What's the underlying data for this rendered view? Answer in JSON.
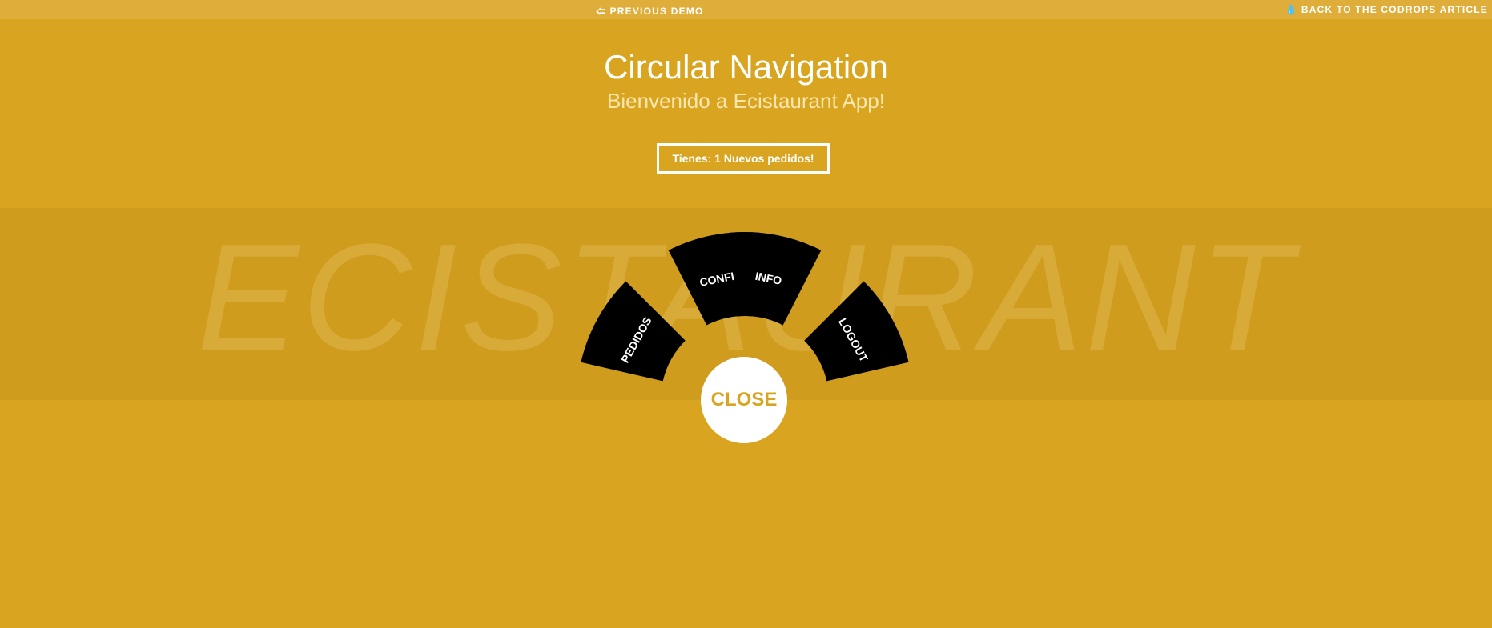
{
  "colors": {
    "background": "#d9a420",
    "band": "#cf9c1d",
    "menu_item": "#000000",
    "text": "#ffffff"
  },
  "top_nav": {
    "previous_demo": "PREVIOUS DEMO",
    "previous_demo_icon": "arrow-left-icon",
    "back_to_article": "BACK TO THE CODROPS ARTICLE",
    "back_to_article_icon": "drop-icon"
  },
  "header": {
    "title": "Circular Navigation",
    "subtitle": "Bienvenido a Ecistaurant App!"
  },
  "orders_button": "Tienes: 1 Nuevos pedidos!",
  "background_word": "ECISTAURANT",
  "circle_menu": {
    "items": [
      {
        "label": "PEDIDOS"
      },
      {
        "label": "CONFIG"
      },
      {
        "label": "INFO"
      },
      {
        "label": "LOGOUT"
      }
    ],
    "close_label": "CLOSE"
  }
}
